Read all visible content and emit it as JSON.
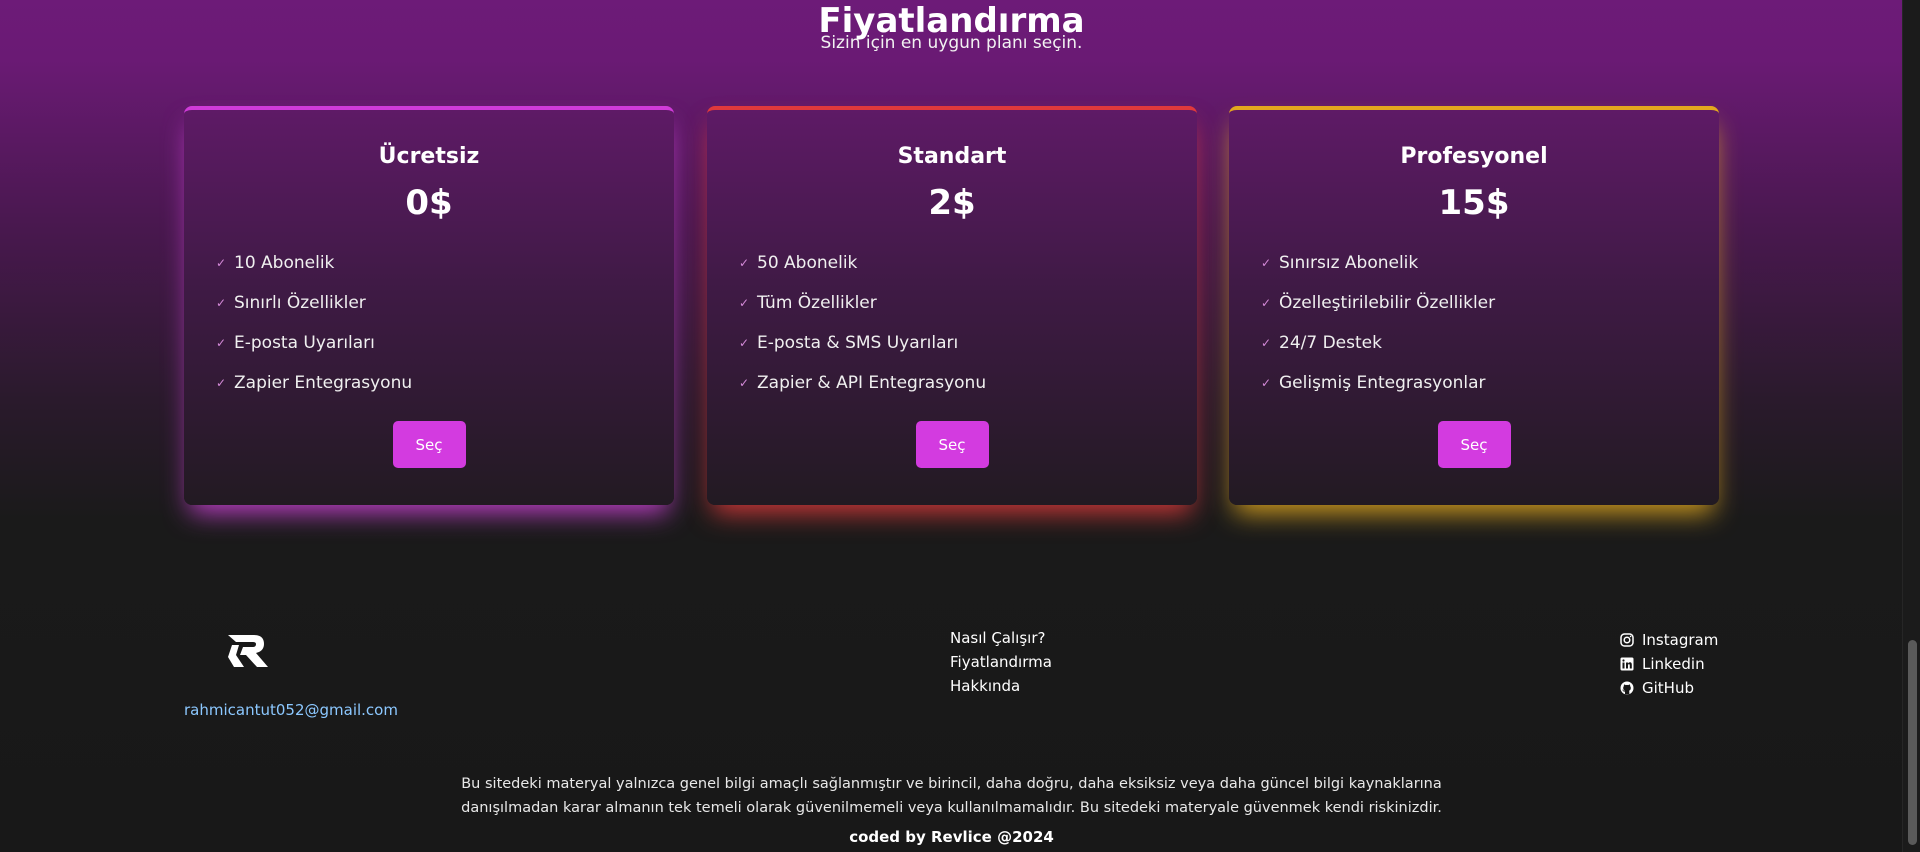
{
  "header": {
    "title": "Fiyatlandırma",
    "subtitle": "Sizin için en uygun planı seçin."
  },
  "plans": [
    {
      "name": "Ücretsiz",
      "price": "0$",
      "accent": "#d13fdc",
      "features": [
        "10 Abonelik",
        "Sınırlı Özellikler",
        "E-posta Uyarıları",
        "Zapier Entegrasyonu"
      ],
      "button": "Seç"
    },
    {
      "name": "Standart",
      "price": "2$",
      "accent": "#e3393c",
      "features": [
        "50 Abonelik",
        "Tüm Özellikler",
        "E-posta & SMS Uyarıları",
        "Zapier & API Entegrasyonu"
      ],
      "button": "Seç"
    },
    {
      "name": "Profesyonel",
      "price": "15$",
      "accent": "#e8ad1c",
      "features": [
        "Sınırsız Abonelik",
        "Özelleştirilebilir Özellikler",
        "24/7 Destek",
        "Gelişmiş Entegrasyonlar"
      ],
      "button": "Seç"
    }
  ],
  "feature_icon": "check-icon",
  "footer": {
    "logo": "revlice-logo",
    "email": "rahmicantut052@gmail.com",
    "nav": [
      "Nasıl Çalışır?",
      "Fiyatlandırma",
      "Hakkında"
    ],
    "social": [
      {
        "label": "Instagram",
        "icon": "instagram-icon"
      },
      {
        "label": "Linkedin",
        "icon": "linkedin-icon"
      },
      {
        "label": "GitHub",
        "icon": "github-icon"
      }
    ],
    "disclaimer_line1": "Bu sitedeki materyal yalnızca genel bilgi amaçlı sağlanmıştır ve birincil, daha doğru, daha eksiksiz veya daha güncel bilgi kaynaklarına",
    "disclaimer_line2": "danışılmadan karar almanın tek temeli olarak güvenilmemeli veya kullanılmamalıdır. Bu sitedeki materyale güvenmek kendi riskinizdir.",
    "credit": "coded by Revlice @2024"
  },
  "colors": {
    "button": "#d33be0",
    "email_link": "#8cc8ff",
    "background": "#171717"
  }
}
